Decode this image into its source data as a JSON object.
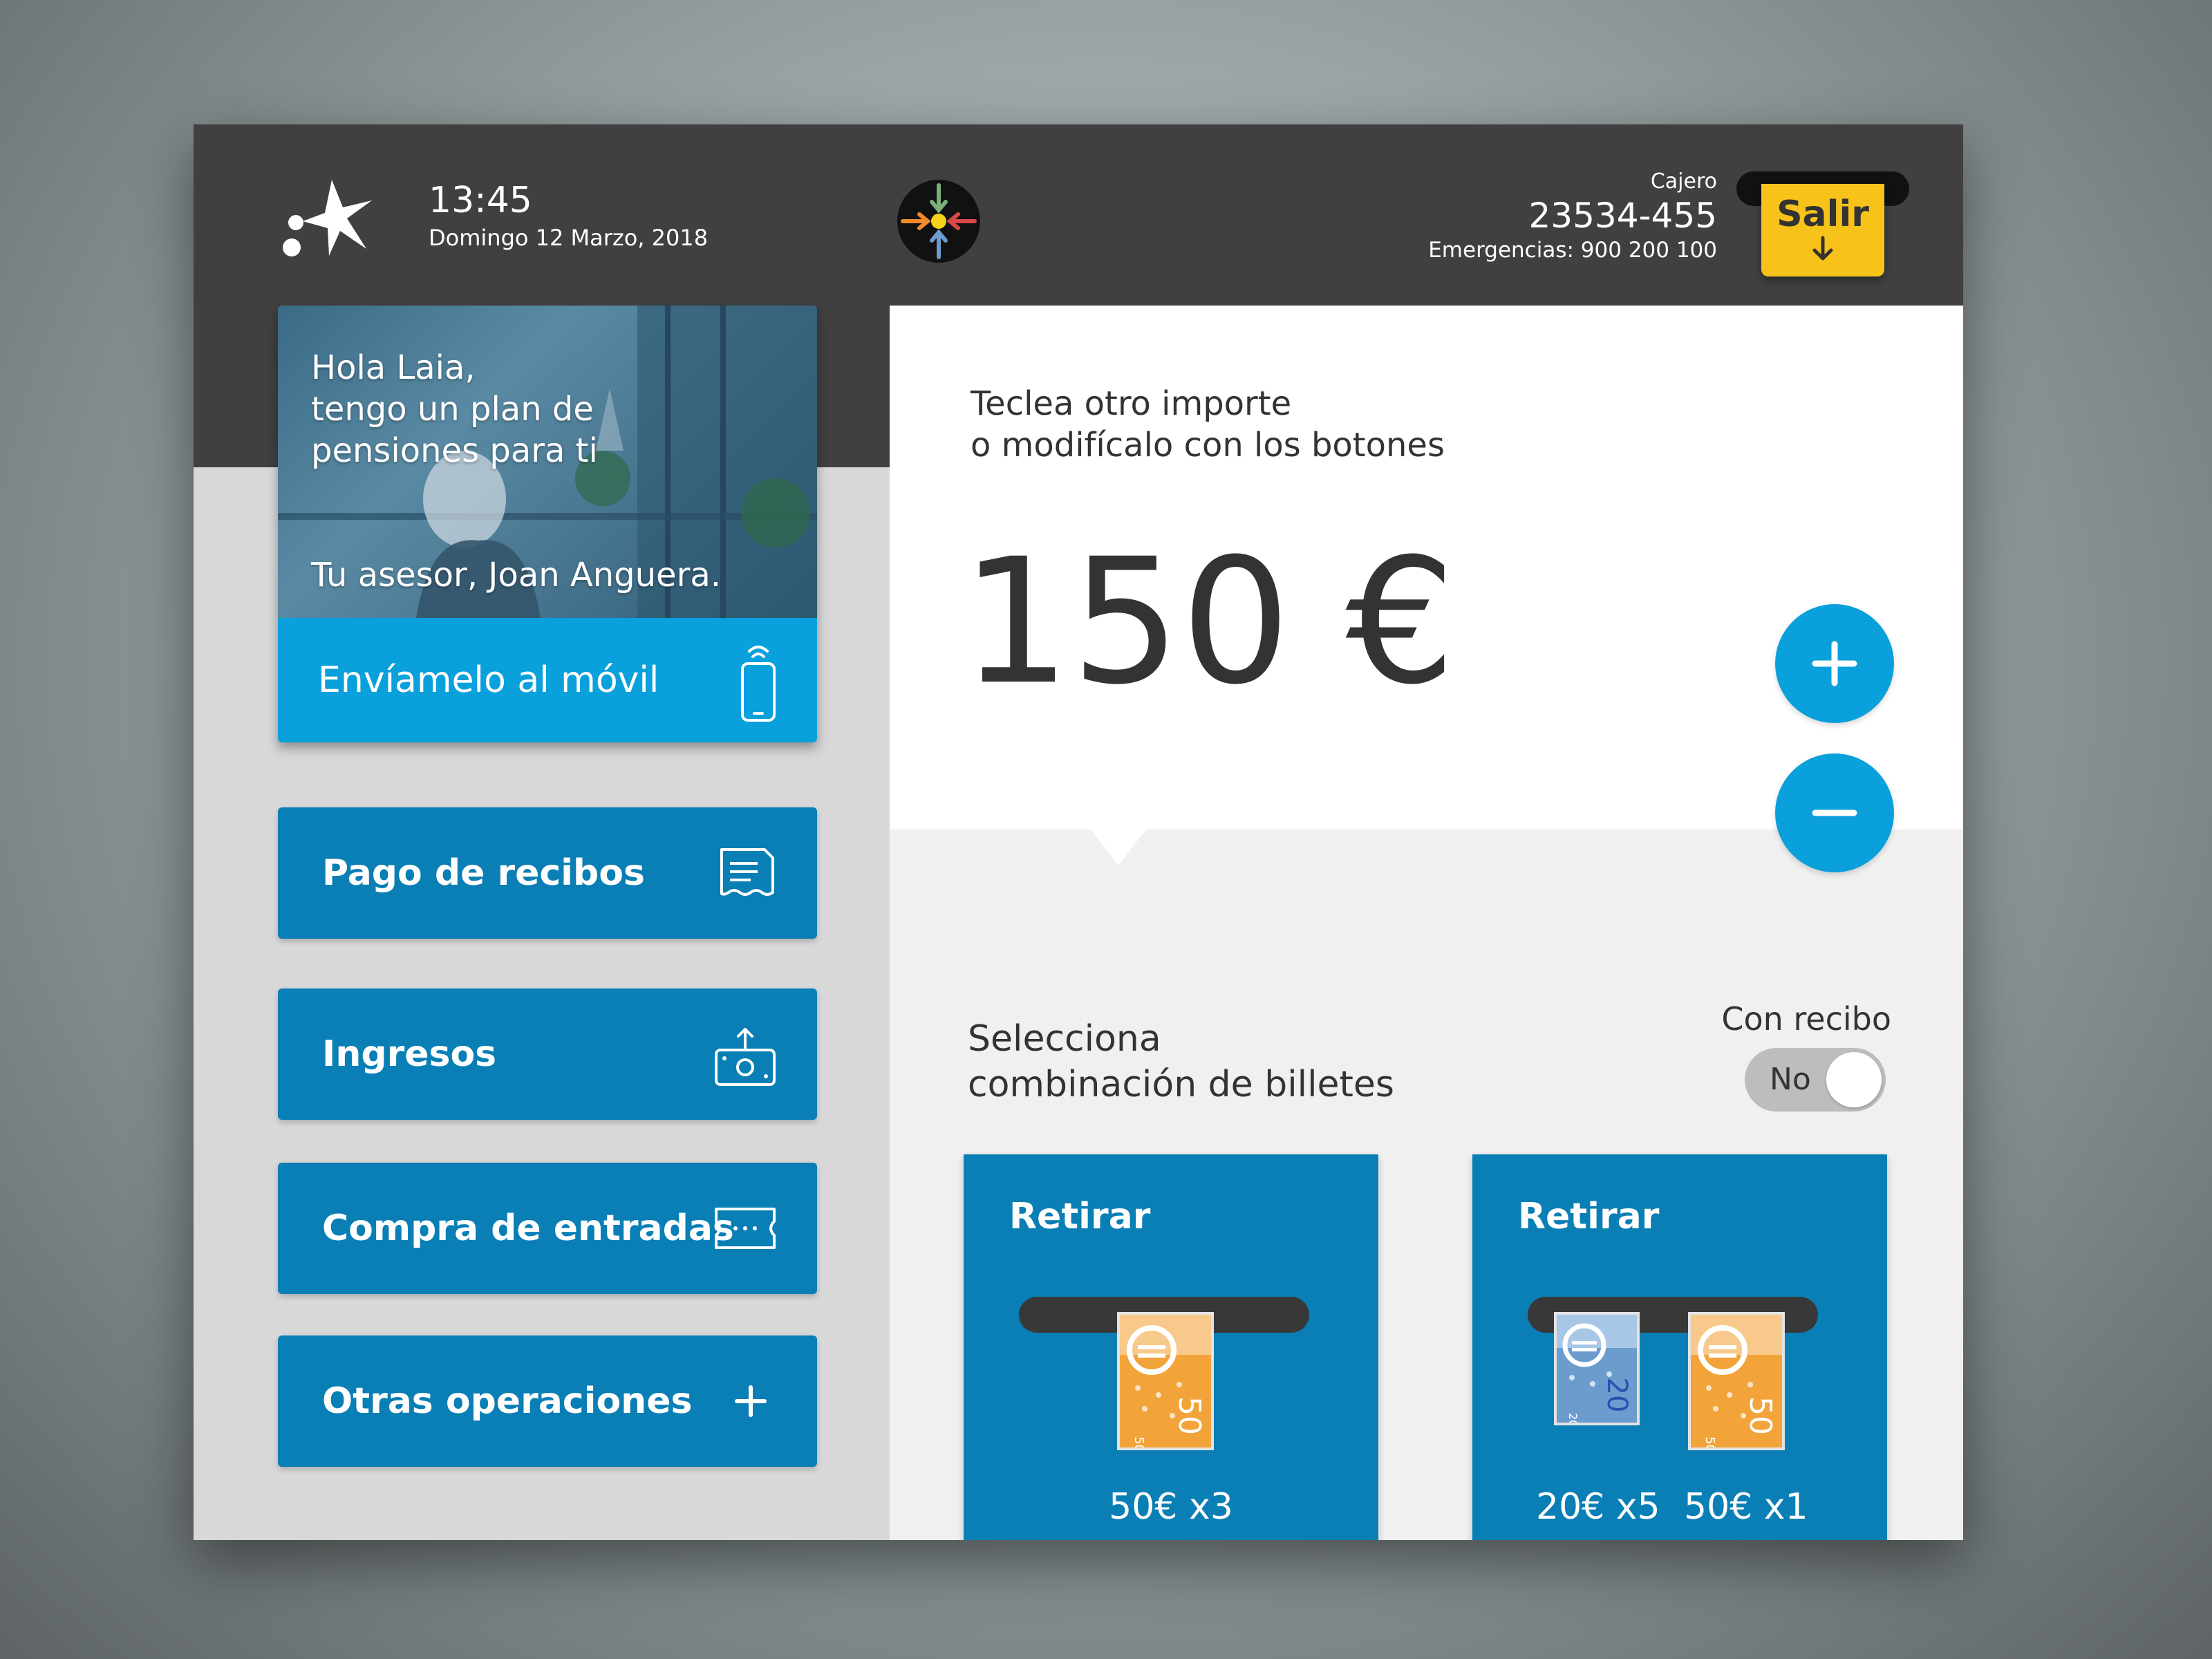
{
  "header": {
    "time": "13:45",
    "date": "Domingo 12 Marzo, 2018",
    "atm_label": "Cajero",
    "atm_number": "23534-455",
    "emergency": "Emergencias: 900 200 100",
    "exit_label": "Salir"
  },
  "promo": {
    "greeting": [
      "Hola Laia,",
      "tengo un plan de",
      "pensiones para ti"
    ],
    "signature": "Tu asesor, Joan Anguera.",
    "action_label": "Envíamelo al móvil"
  },
  "menu": {
    "items": [
      {
        "label": "Pago de recibos",
        "icon": "receipt-icon"
      },
      {
        "label": "Ingresos",
        "icon": "deposit-icon"
      },
      {
        "label": "Compra de entradas",
        "icon": "ticket-icon"
      },
      {
        "label": "Otras operaciones",
        "icon": "plus-icon"
      }
    ]
  },
  "amount_panel": {
    "instruction": [
      "Teclea otro importe",
      "o modifícalo con los botones"
    ],
    "amount": "150 €"
  },
  "bills": {
    "title": [
      "Selecciona",
      "combinación de billetes"
    ],
    "receipt_label": "Con recibo",
    "receipt_value": "No",
    "options": [
      {
        "title": "Retirar",
        "breakdown": [
          "50€ x3"
        ]
      },
      {
        "title": "Retirar",
        "breakdown": [
          "20€ x5",
          "50€ x1"
        ]
      }
    ]
  },
  "colors": {
    "header": "#404040",
    "primary_blue": "#0a7fb5",
    "light_blue": "#0aa0dc",
    "exit_yellow": "#f7c31a",
    "note_50": "#f2a43a",
    "note_20": "#6b9ccd"
  }
}
